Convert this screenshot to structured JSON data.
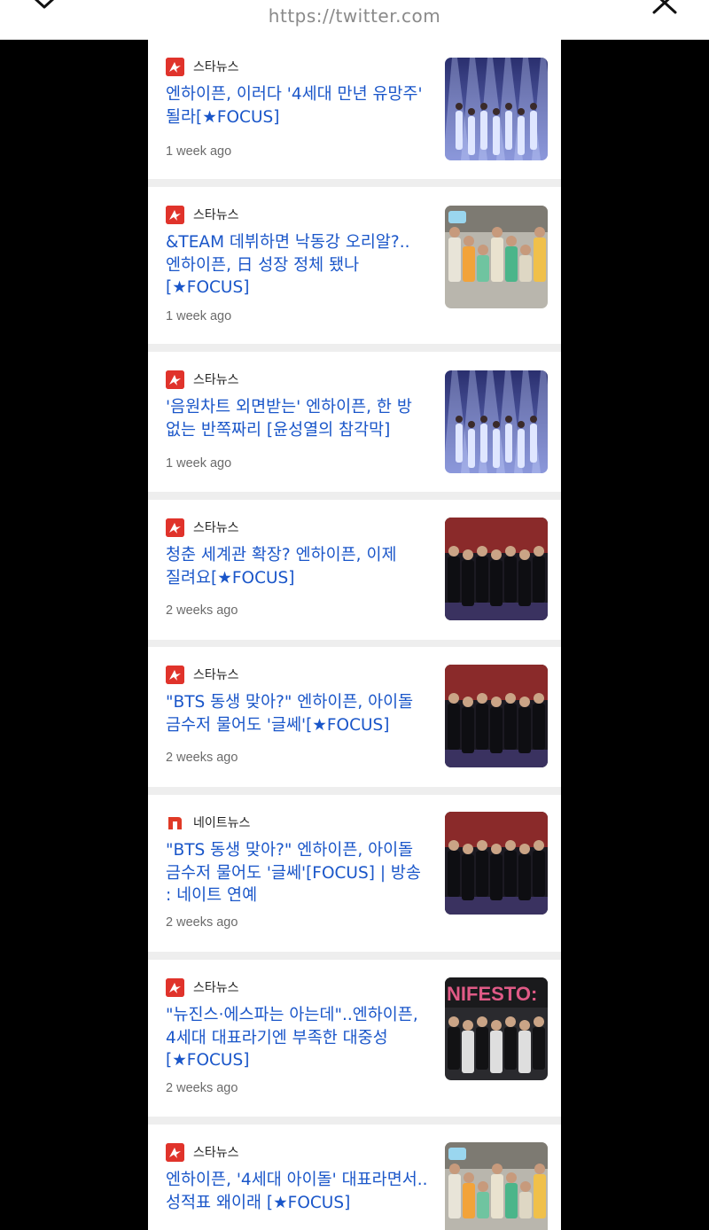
{
  "browser": {
    "url": "https://twitter.com",
    "back_icon": "chevron-down-icon",
    "close_icon": "close-icon"
  },
  "colors": {
    "headline": "#1a56c9",
    "starnews_brand": "#e0332b",
    "nate_brand": "#e03a26"
  },
  "articles": [
    {
      "source": "스타뉴스",
      "source_icon": "starnews-logo-icon",
      "headline": "엔하이픈, 이러다 '4세대 만년 유망주' 될라[★FOCUS]",
      "time": "1 week ago",
      "thumb": "stage-blue"
    },
    {
      "source": "스타뉴스",
      "source_icon": "starnews-logo-icon",
      "headline": "&TEAM 데뷔하면 낙동강 오리알?.. 엔하이픈, 日 성장 정체 됐나 [★FOCUS]",
      "time": "1 week ago",
      "thumb": "group-colorful"
    },
    {
      "source": "스타뉴스",
      "source_icon": "starnews-logo-icon",
      "headline": "'음원차트 외면받는' 엔하이픈, 한 방 없는 반쪽짜리 [윤성열의 참각막]",
      "time": "1 week ago",
      "thumb": "stage-blue"
    },
    {
      "source": "스타뉴스",
      "source_icon": "starnews-logo-icon",
      "headline": "청춘 세계관 확장? 엔하이픈, 이제 질려요[★FOCUS]",
      "time": "2 weeks ago",
      "thumb": "stage-red"
    },
    {
      "source": "스타뉴스",
      "source_icon": "starnews-logo-icon",
      "headline": "\"BTS 동생 맞아?\" 엔하이픈, 아이돌 금수저 물어도 '글쎄'[★FOCUS]",
      "time": "2 weeks ago",
      "thumb": "stage-red"
    },
    {
      "source": "네이트뉴스",
      "source_icon": "nate-logo-icon",
      "headline": "\"BTS 동생 맞아?\" 엔하이픈, 아이돌 금수저 물어도 '글쎄'[FOCUS] | 방송 : 네이트 연예",
      "time": "2 weeks ago",
      "thumb": "stage-red"
    },
    {
      "source": "스타뉴스",
      "source_icon": "starnews-logo-icon",
      "headline": "\"뉴진스·에스파는 아는데\"..엔하이픈, 4세대 대표라기엔 부족한 대중성 [★FOCUS]",
      "time": "2 weeks ago",
      "thumb": "manifesto"
    },
    {
      "source": "스타뉴스",
      "source_icon": "starnews-logo-icon",
      "headline": "엔하이픈, '4세대 아이돌' 대표라면서..성적표 왜이래 [★FOCUS]",
      "time": "",
      "thumb": "group-colorful"
    }
  ]
}
